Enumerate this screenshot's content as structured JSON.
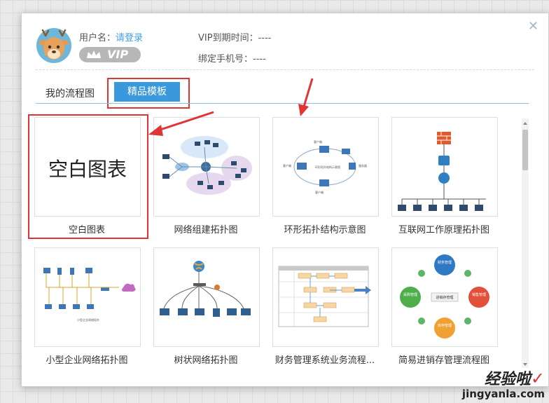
{
  "user": {
    "username_label": "用户名：",
    "login_link": "请登录",
    "vip_badge": "VIP",
    "vip_expiry_label": "VIP到期时间：----",
    "phone_label": "绑定手机号：----"
  },
  "tabs": {
    "my_flowcharts": "我的流程图",
    "templates": "精品模板"
  },
  "templates": [
    {
      "label": "空白图表",
      "preview_text": "空白图表"
    },
    {
      "label": "网络组建拓扑图"
    },
    {
      "label": "环形拓扑结构示意图"
    },
    {
      "label": "互联网工作原理拓扑图"
    },
    {
      "label": "小型企业网络拓扑图"
    },
    {
      "label": "树状网络拓扑图"
    },
    {
      "label": "财务管理系统业务流程..."
    },
    {
      "label": "简易进销存管理流程图"
    }
  ],
  "ring_chart": {
    "nodes": [
      "财务管理",
      "销售管理",
      "库存管理",
      "采购管理"
    ],
    "center": "进销存管理"
  },
  "watermark": {
    "cn": "经验啦",
    "check": "✓",
    "url": "jingyanla.com"
  },
  "colors": {
    "accent": "#3a98dc",
    "annotation_red": "#e03535"
  },
  "icons": [
    "close-icon",
    "crown-icon",
    "deer-avatar"
  ]
}
